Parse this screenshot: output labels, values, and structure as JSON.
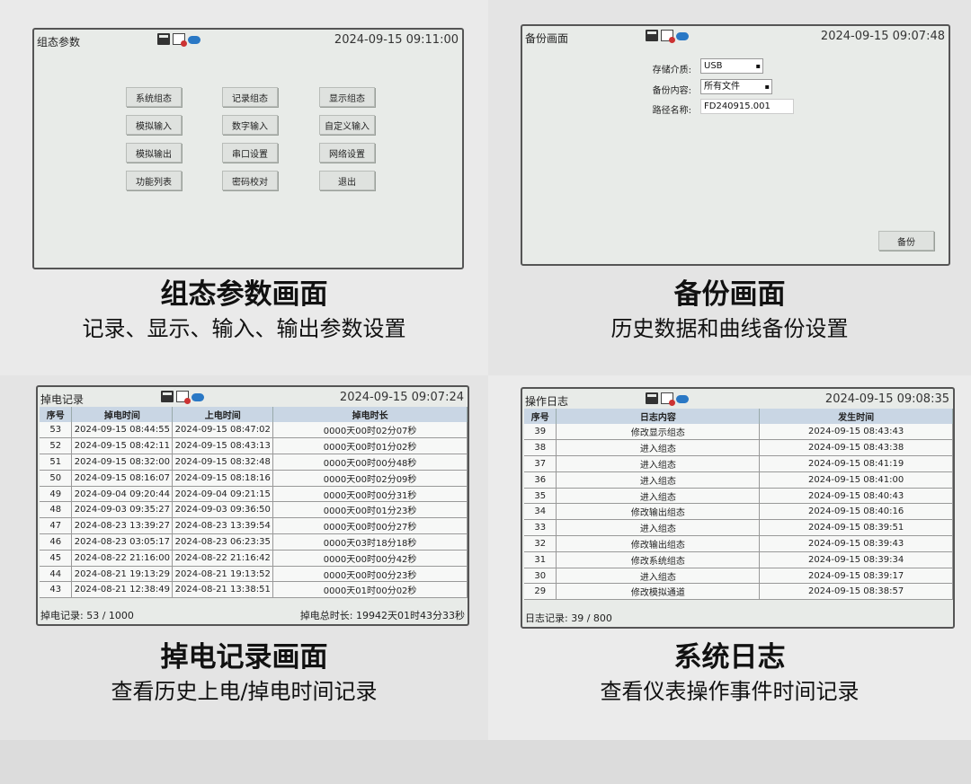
{
  "panel1": {
    "title": "组态参数",
    "clock": "2024-09-15 09:11:00",
    "buttons": [
      "系统组态",
      "记录组态",
      "显示组态",
      "模拟输入",
      "数字输入",
      "自定义输入",
      "模拟输出",
      "串口设置",
      "网络设置",
      "功能列表",
      "密码校对",
      "退出"
    ],
    "caption": "组态参数画面",
    "subcaption": "记录、显示、输入、输出参数设置"
  },
  "panel2": {
    "title": "备份画面",
    "clock": "2024-09-15 09:07:48",
    "storage_label": "存储介质:",
    "storage_value": "USB",
    "content_label": "备份内容:",
    "content_value": "所有文件",
    "path_label": "路径名称:",
    "path_value": "FD240915.001",
    "backup_button": "备份",
    "caption": "备份画面",
    "subcaption": "历史数据和曲线备份设置"
  },
  "panel3": {
    "title": "掉电记录",
    "clock": "2024-09-15 09:07:24",
    "headers": [
      "序号",
      "掉电时间",
      "上电时间",
      "掉电时长"
    ],
    "rows": [
      [
        "53",
        "2024-09-15 08:44:55",
        "2024-09-15 08:47:02",
        "0000天00时02分07秒"
      ],
      [
        "52",
        "2024-09-15 08:42:11",
        "2024-09-15 08:43:13",
        "0000天00时01分02秒"
      ],
      [
        "51",
        "2024-09-15 08:32:00",
        "2024-09-15 08:32:48",
        "0000天00时00分48秒"
      ],
      [
        "50",
        "2024-09-15 08:16:07",
        "2024-09-15 08:18:16",
        "0000天00时02分09秒"
      ],
      [
        "49",
        "2024-09-04 09:20:44",
        "2024-09-04 09:21:15",
        "0000天00时00分31秒"
      ],
      [
        "48",
        "2024-09-03 09:35:27",
        "2024-09-03 09:36:50",
        "0000天00时01分23秒"
      ],
      [
        "47",
        "2024-08-23 13:39:27",
        "2024-08-23 13:39:54",
        "0000天00时00分27秒"
      ],
      [
        "46",
        "2024-08-23 03:05:17",
        "2024-08-23 06:23:35",
        "0000天03时18分18秒"
      ],
      [
        "45",
        "2024-08-22 21:16:00",
        "2024-08-22 21:16:42",
        "0000天00时00分42秒"
      ],
      [
        "44",
        "2024-08-21 19:13:29",
        "2024-08-21 19:13:52",
        "0000天00时00分23秒"
      ],
      [
        "43",
        "2024-08-21 12:38:49",
        "2024-08-21 13:38:51",
        "0000天01时00分02秒"
      ]
    ],
    "status_left": "掉电记录: 53 / 1000",
    "status_right": "掉电总时长: 19942天01时43分33秒",
    "caption": "掉电记录画面",
    "subcaption": "查看历史上电/掉电时间记录"
  },
  "panel4": {
    "title": "操作日志",
    "clock": "2024-09-15 09:08:35",
    "headers": [
      "序号",
      "日志内容",
      "发生时间"
    ],
    "rows": [
      [
        "39",
        "修改显示组态",
        "2024-09-15 08:43:43"
      ],
      [
        "38",
        "进入组态",
        "2024-09-15 08:43:38"
      ],
      [
        "37",
        "进入组态",
        "2024-09-15 08:41:19"
      ],
      [
        "36",
        "进入组态",
        "2024-09-15 08:41:00"
      ],
      [
        "35",
        "进入组态",
        "2024-09-15 08:40:43"
      ],
      [
        "34",
        "修改输出组态",
        "2024-09-15 08:40:16"
      ],
      [
        "33",
        "进入组态",
        "2024-09-15 08:39:51"
      ],
      [
        "32",
        "修改输出组态",
        "2024-09-15 08:39:43"
      ],
      [
        "31",
        "修改系统组态",
        "2024-09-15 08:39:34"
      ],
      [
        "30",
        "进入组态",
        "2024-09-15 08:39:17"
      ],
      [
        "29",
        "修改模拟通道",
        "2024-09-15 08:38:57"
      ]
    ],
    "status_left": "日志记录: 39 / 800",
    "caption": "系统日志",
    "subcaption": "查看仪表操作事件时间记录"
  }
}
